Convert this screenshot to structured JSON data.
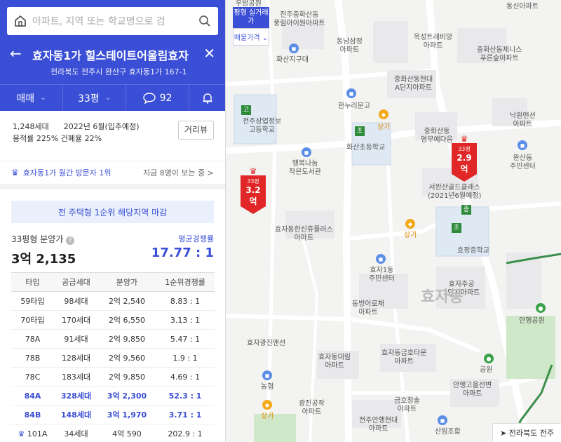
{
  "search": {
    "placeholder": "아파트, 지역 또는 학교명으로 검"
  },
  "header": {
    "title": "효자동1가 힐스테이트어울림효자",
    "address": "전라북도 전주시 완산구 효자동1가 167-1"
  },
  "tabs": {
    "deal_type": "매매",
    "area": "33평",
    "comment_count": "92"
  },
  "stats": {
    "line1": "1,248세대      2022년 6월(입주예정)",
    "line2": "용적률 225%  건폐율 22%",
    "street_view": "거리뷰"
  },
  "visitor": {
    "label": "효자동1가 월간 방문자 1위",
    "viewers": "지금 8명이 보는 중 >"
  },
  "notice": "전 주택형 1순위 해당지역 마감",
  "price": {
    "label": "33평형 분양가",
    "value": "3억 2,135",
    "comp_label": "평균경쟁률",
    "comp_value": "17.77 : 1"
  },
  "table": {
    "headers": [
      "타입",
      "공급세대",
      "분양가",
      "1순위경쟁률"
    ],
    "rows": [
      [
        "59타입",
        "98세대",
        "2억 2,540",
        "8.83 : 1"
      ],
      [
        "70타입",
        "170세대",
        "2억 6,550",
        "3.13 : 1"
      ],
      [
        "78A",
        "91세대",
        "2억 9,850",
        "5.47 : 1"
      ],
      [
        "78B",
        "128세대",
        "2억 9,560",
        "1.9 : 1"
      ],
      [
        "78C",
        "183세대",
        "2억 9,850",
        "4.69 : 1"
      ],
      [
        "84A",
        "328세대",
        "3억 2,300",
        "52.3 : 1"
      ],
      [
        "84B",
        "148세대",
        "3억 1,970",
        "3.71 : 1"
      ],
      [
        "101A",
        "34세대",
        "4억 590",
        "202.9 : 1"
      ]
    ]
  },
  "map": {
    "toggle_top": "평형 실거래가",
    "toggle_bottom": "매물가격 ⌄",
    "labels": {
      "l1": "전주중화산동\n풍림아이원아파트",
      "l2": "동남삼정\n아파트",
      "l3": "옥성트레비앙\n아파트",
      "l4": "중화산동제니스\n푸른숲아파트",
      "l5": "화산지구대",
      "l6": "중화산동현대\nA단지아파트",
      "l7": "한누리문고",
      "l8": "낙원맨션\n아파트",
      "l9": "중화산동\n영무예다음",
      "l10": "전주상업정보\n고등학교",
      "l11": "화산초등학교",
      "l12": "행복나눔\n작은도서관",
      "l13": "서완산골드클래스\n(2021년6월예정)",
      "l14": "완산동\n주민센터",
      "l15": "효자동한신휴플러스\n아파트",
      "l16": "효정중학교",
      "l17": "효자1동\n주민센터",
      "l18": "효자주공\n3단지아파트",
      "l19": "동방아로채\n아파트",
      "l20": "효자광진맨션",
      "l21": "효자동대림\n아파트",
      "l22": "효자동금호타운\n아파트",
      "l23": "안행고을선변\n아파트",
      "l24": "금호청솔\n아파트",
      "l25": "광진공작\n아파트",
      "l26": "전주안행현대\n아파트",
      "l27": "동신아파트",
      "l28": "안행공원",
      "l29": "공원",
      "l30": "산림조합",
      "l31": "농협",
      "l32": "상가",
      "l33": "상가",
      "l34": "상가",
      "l35": "우방공원"
    },
    "district": "효자동",
    "markers": [
      {
        "area": "33평",
        "price": "3.2억"
      },
      {
        "area": "33평",
        "price": "2.9억"
      }
    ],
    "flags": {
      "f1": "고",
      "f2": "초",
      "f3": "중",
      "f4": "초"
    },
    "location": "➤ 전라북도 전주"
  },
  "colors": {
    "brand": "#3b4fd6",
    "marker": "#e02626"
  }
}
